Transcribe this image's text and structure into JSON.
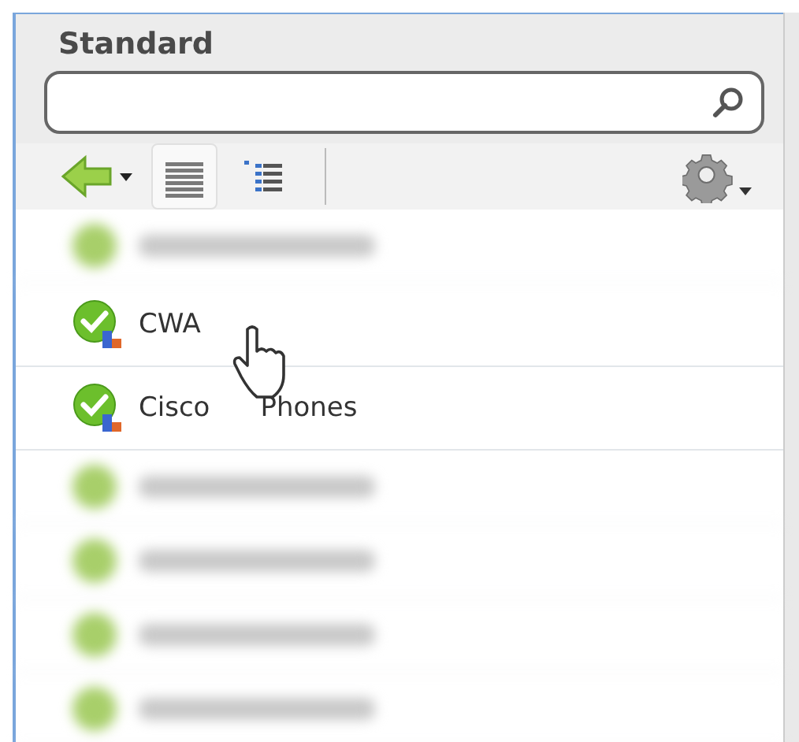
{
  "panel": {
    "title": "Standard"
  },
  "view_buttons": [
    {
      "kind": "list",
      "selected": true
    },
    {
      "kind": "details",
      "selected": false
    }
  ],
  "items": [
    {
      "kind": "blurred"
    },
    {
      "kind": "item",
      "labels": [
        "CWA"
      ]
    },
    {
      "kind": "item",
      "labels": [
        "Cisco",
        "Phones"
      ]
    },
    {
      "kind": "blurred"
    },
    {
      "kind": "blurred"
    },
    {
      "kind": "blurred"
    },
    {
      "kind": "blurred"
    }
  ]
}
